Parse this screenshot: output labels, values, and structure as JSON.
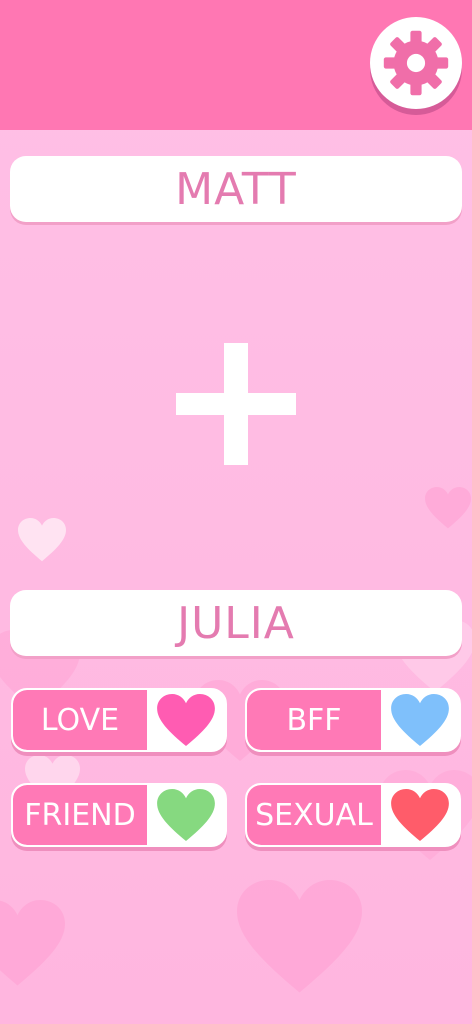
{
  "names": {
    "first": "MATT",
    "second": "JULIA"
  },
  "settings": {
    "icon": "gear-icon"
  },
  "operator": {
    "icon": "plus-icon"
  },
  "modes": [
    {
      "label": "LOVE",
      "heart_color": "#ff5cb2"
    },
    {
      "label": "BFF",
      "heart_color": "#7fc0fb"
    },
    {
      "label": "FRIEND",
      "heart_color": "#86d980"
    },
    {
      "label": "SEXUAL",
      "heart_color": "#ff5c6a"
    }
  ],
  "colors": {
    "header": "#ff77b3",
    "background": "#ffbde4",
    "name_text": "#e47bb0",
    "button_fill": "#ff79b6"
  }
}
